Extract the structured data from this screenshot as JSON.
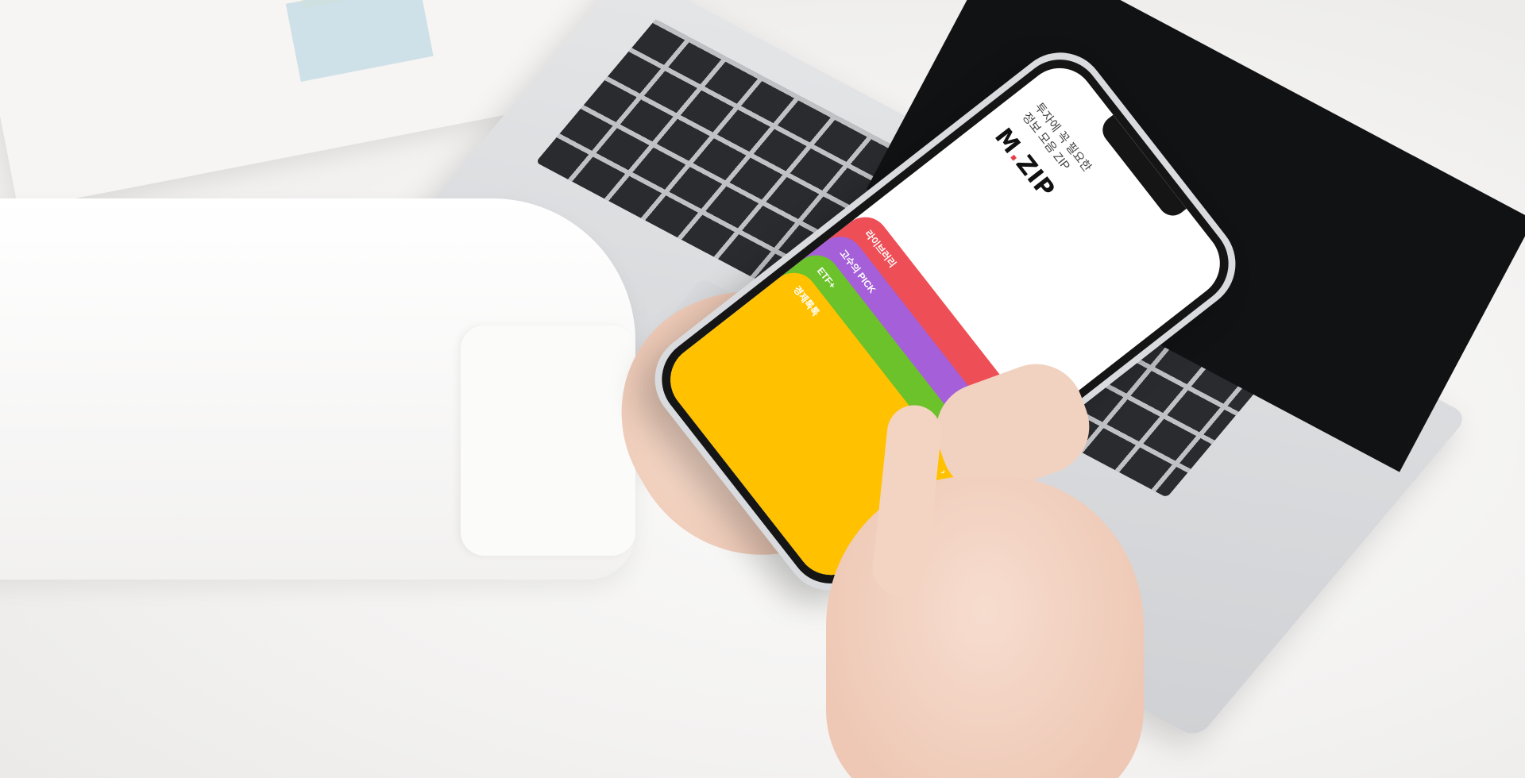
{
  "app": {
    "tagline_line1": "투자에 꼭 필요한",
    "tagline_line2": "정보 모음 ZIP",
    "logo_left": "M",
    "logo_dot": ".",
    "logo_right": "ZIP"
  },
  "menu": [
    {
      "label": "라이브러리",
      "color": "#ee4e55"
    },
    {
      "label": "고수의 PICK",
      "color": "#a55fd9"
    },
    {
      "label": "ETF+",
      "color": "#6cc22a"
    },
    {
      "label": "경제톡톡",
      "color": "#ffc100"
    }
  ],
  "icons": {
    "chevron": "›"
  }
}
